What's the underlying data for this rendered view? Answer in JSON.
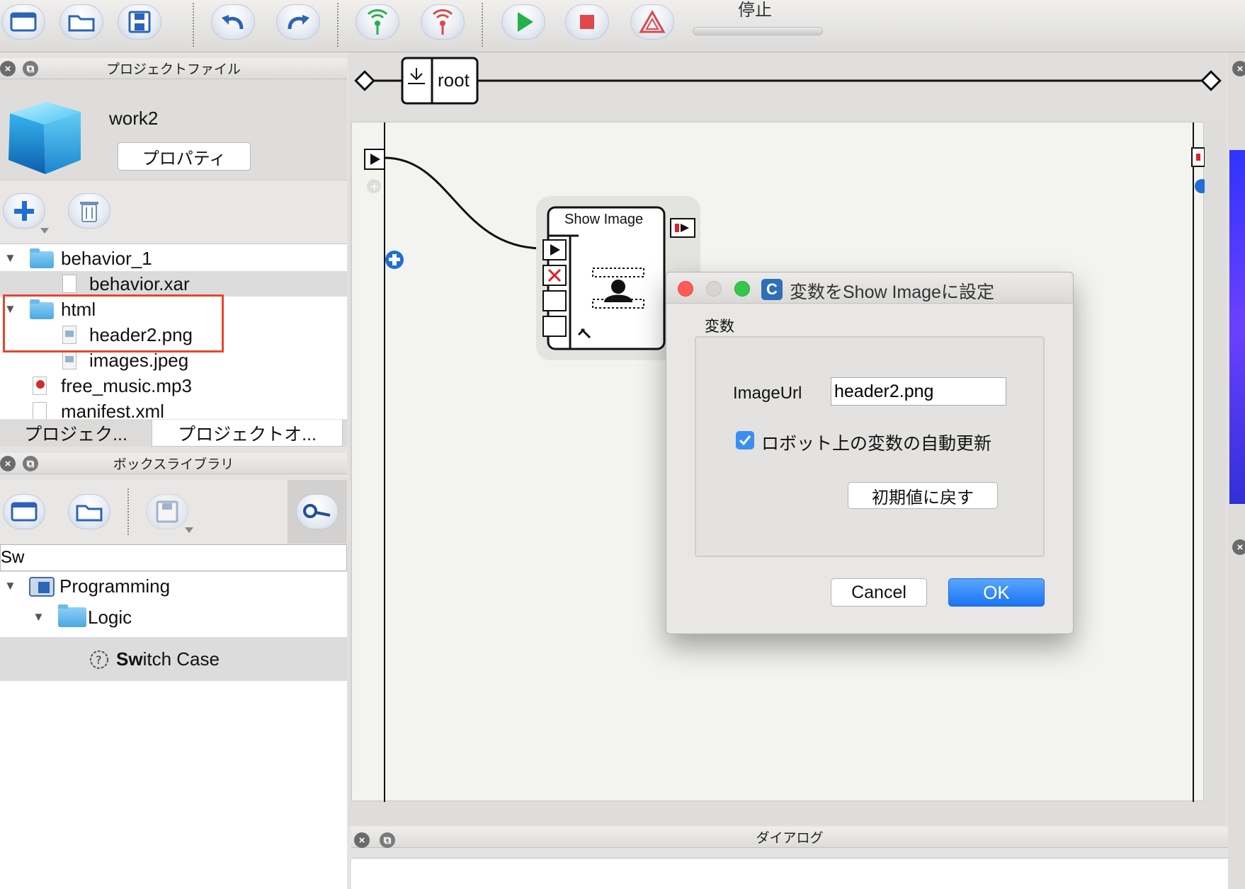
{
  "toolbar": {
    "buttons": [
      {
        "icon": "new-window-icon"
      },
      {
        "icon": "open-folder-icon"
      },
      {
        "icon": "save-icon"
      },
      {
        "icon": "undo-icon"
      },
      {
        "icon": "redo-icon"
      },
      {
        "icon": "connect-icon"
      },
      {
        "icon": "disconnect-icon"
      },
      {
        "icon": "play-icon"
      },
      {
        "icon": "stop-icon"
      },
      {
        "icon": "warning-icon"
      }
    ],
    "status_label": "停止"
  },
  "project_panel": {
    "title": "プロジェクトファイル",
    "project_name": "work2",
    "properties_label": "プロパティ",
    "files": [
      {
        "label": "behavior_1",
        "type": "folder",
        "expanded": true
      },
      {
        "label": "behavior.xar",
        "type": "file"
      },
      {
        "label": "html",
        "type": "folder",
        "expanded": true
      },
      {
        "label": "header2.png",
        "type": "image"
      },
      {
        "label": "images.jpeg",
        "type": "image"
      },
      {
        "label": "free_music.mp3",
        "type": "audio"
      },
      {
        "label": "manifest.xml",
        "type": "file"
      }
    ],
    "tabs": [
      "プロジェク...",
      "プロジェクトオ..."
    ]
  },
  "box_library": {
    "title": "ボックスライブラリ",
    "search_value": "Sw",
    "tree": [
      {
        "label": "Programming"
      },
      {
        "label": "Logic"
      },
      {
        "label": "Switch Case",
        "match": "Sw",
        "rest": "itch Case"
      }
    ]
  },
  "canvas": {
    "root_label": "root",
    "box_title": "Show Image"
  },
  "dialog_panel": {
    "title": "ダイアログ"
  },
  "modal": {
    "title": "変数をShow Imageに設定",
    "app_icon_letter": "C",
    "group_label": "変数",
    "field_label": "ImageUrl",
    "field_value": "header2.png",
    "checkbox_label": "ロボット上の変数の自動更新",
    "checkbox_checked": true,
    "reset_label": "初期値に戻す",
    "cancel_label": "Cancel",
    "ok_label": "OK"
  },
  "colors": {
    "accent_blue": "#1a74f2",
    "highlight_red": "#e8442c",
    "play_green": "#22b14c",
    "stop_red": "#e0474c"
  }
}
